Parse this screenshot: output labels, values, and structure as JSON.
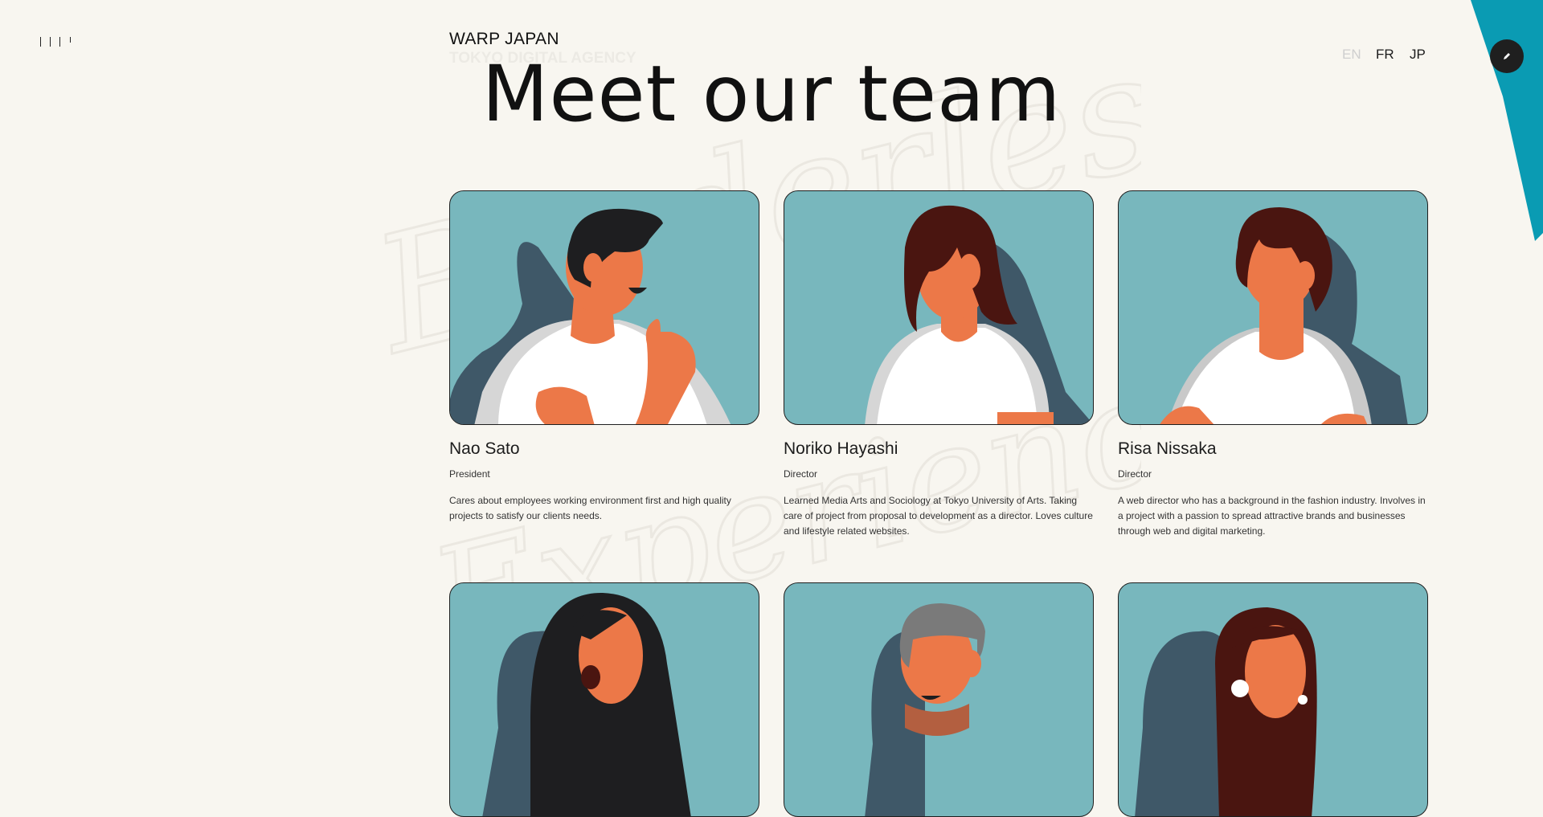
{
  "brand": {
    "name": "WARP JAPAN",
    "tagline": "TOKYO DIGITAL AGENCY"
  },
  "languages": [
    {
      "label": "EN",
      "active": true
    },
    {
      "label": "FR",
      "active": false
    },
    {
      "label": "JP",
      "active": false
    }
  ],
  "background_script": {
    "line1": "Borderless",
    "line2": "Experience"
  },
  "headline": "Meet our team",
  "team": [
    {
      "name": "Nao Sato",
      "role": "President",
      "bio": "Cares about employees working environment first and high quality projects to satisfy our clients needs."
    },
    {
      "name": "Noriko Hayashi",
      "role": "Director",
      "bio": "Learned Media Arts and Sociology at Tokyo University of Arts. Taking care of project from proposal to development as a director. Loves culture and lifestyle related websites."
    },
    {
      "name": "Risa Nissaka",
      "role": "Director",
      "bio": "A web director who has a background in the fashion industry. Involves in a project with a passion to spread attractive brands and businesses through web and digital marketing."
    }
  ],
  "colors": {
    "background": "#f8f6f0",
    "photo_bg": "#78b7bd",
    "accent_stripe": "#0a9bb3",
    "skin": "#ec7848",
    "shadow": "#3f5868",
    "shirt": "#ffffff"
  },
  "icons": {
    "menu": "menu-lines-icon",
    "edit": "pencil-icon"
  }
}
